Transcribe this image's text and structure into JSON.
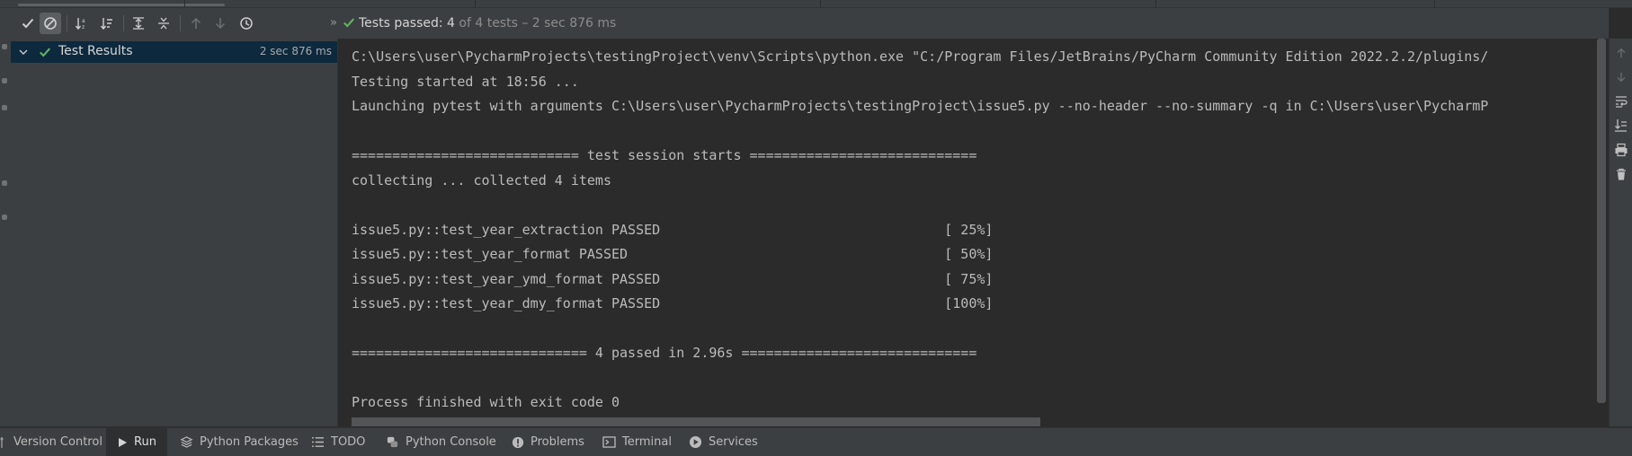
{
  "toolbar": {
    "status_passed_label": "Tests passed: 4",
    "status_detail": " of 4 tests – 2 sec 876 ms",
    "more_chevron": "»"
  },
  "tree": {
    "root_label": "Test Results",
    "root_time": "2 sec 876 ms"
  },
  "console": {
    "lines": [
      "C:\\Users\\user\\PycharmProjects\\testingProject\\venv\\Scripts\\python.exe \"C:/Program Files/JetBrains/PyCharm Community Edition 2022.2.2/plugins/",
      "Testing started at 18:56 ...",
      "Launching pytest with arguments C:\\Users\\user\\PycharmProjects\\testingProject\\issue5.py --no-header --no-summary -q in C:\\Users\\user\\PycharmP",
      "",
      "============================ test session starts ============================",
      "collecting ... collected 4 items",
      "",
      "issue5.py::test_year_extraction PASSED                                   [ 25%]",
      "issue5.py::test_year_format PASSED                                       [ 50%]",
      "issue5.py::test_year_ymd_format PASSED                                   [ 75%]",
      "issue5.py::test_year_dmy_format PASSED                                   [100%]",
      "",
      "============================= 4 passed in 2.96s =============================",
      "",
      "Process finished with exit code 0"
    ]
  },
  "bottom_tabs": {
    "version_control": "Version Control",
    "run": "Run",
    "python_packages": "Python Packages",
    "todo": "TODO",
    "python_console": "Python Console",
    "problems": "Problems",
    "terminal": "Terminal",
    "services": "Services"
  },
  "colors": {
    "pass_green": "#5fb55f",
    "selection": "#0d293e"
  }
}
